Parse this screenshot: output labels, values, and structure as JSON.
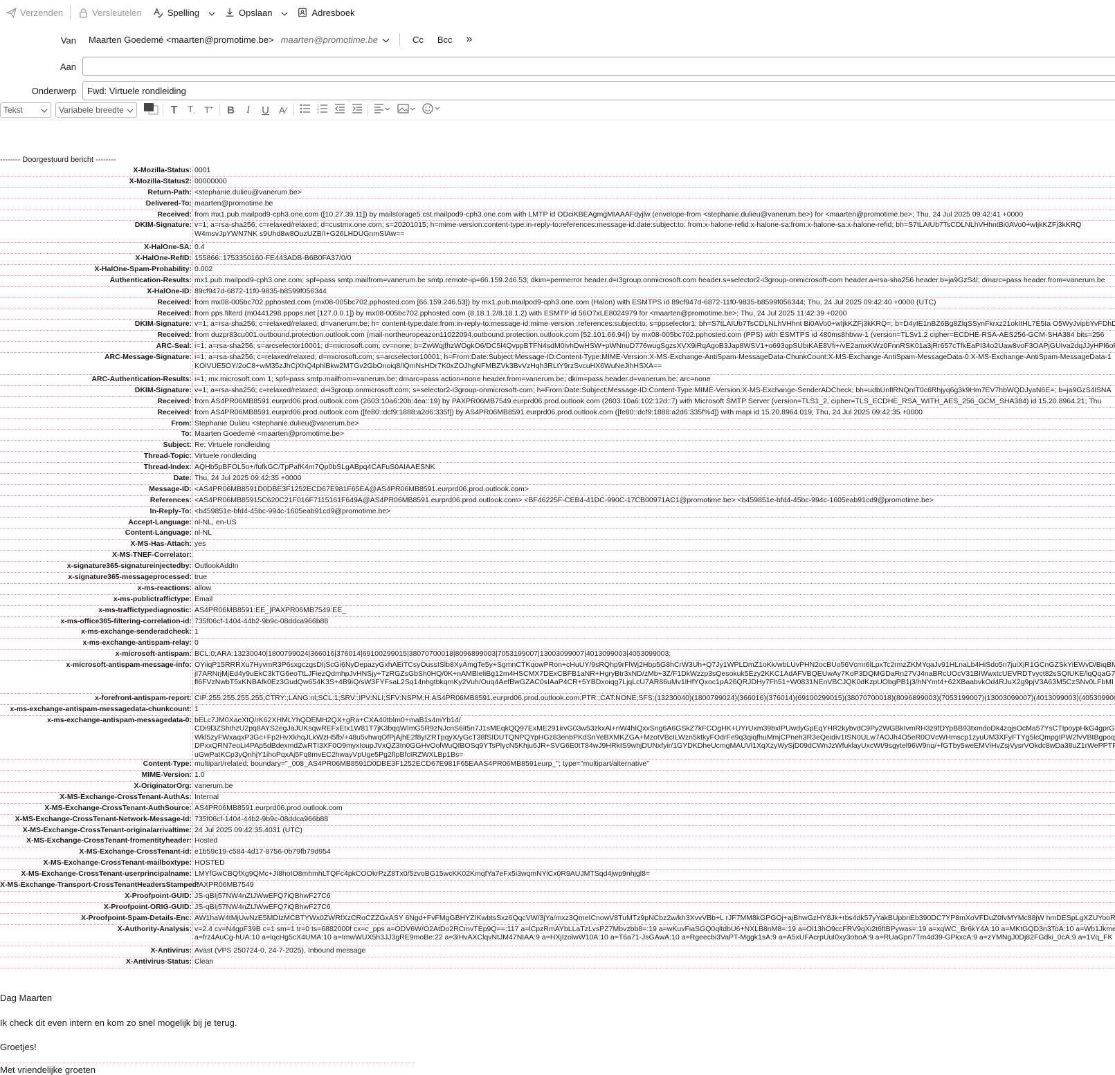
{
  "toolbar": {
    "send": "Verzenden",
    "encrypt": "Versleutelen",
    "spelling": "Spelling",
    "save": "Opslaan",
    "addressbook": "Adresboek"
  },
  "compose": {
    "from_label": "Van",
    "from_value": "Maarten Goedemé <maarten@promotime.be>",
    "from_alt": "maarten@promotime.be",
    "cc": "Cc",
    "bcc": "Bcc",
    "more": "»",
    "to_label": "Aan",
    "to_value": "",
    "subject_label": "Onderwerp",
    "subject_value": "Fwd: Virtuele rondleiding"
  },
  "format": {
    "paragraph": "Tekst",
    "font": "Variabele breedte"
  },
  "body": {
    "forward_header": "-------- Doorgestuurd bericht --------",
    "headers": [
      {
        "name": "X-Mozilla-Status:",
        "value": "0001"
      },
      {
        "name": "X-Mozilla-Status2:",
        "value": "00000000"
      },
      {
        "name": "Return-Path:",
        "value": "<stephanie.dulieu@vanerum.be>"
      },
      {
        "name": "Delivered-To:",
        "value": "maarten@promotime.be"
      },
      {
        "name": "Received:",
        "value": "from mx1.pub.mailpod9-cph3.one.com ([10.27.39.11]) by mailstorage5.cst.mailpod9-cph3.one.com with LMTP id ODciKBEAgmgMIAAAFdyjlw (envelope-from <stephanie.dulieu@vanerum.be>) for <maarten@promotime.be>; Thu, 24 Jul 2025 09:42:41 +0000"
      },
      {
        "name": "DKIM-Signature:",
        "value": "v=1; a=rsa-sha256; c=relaxed/relaxed; d=custmx.one.com; s=20201015; h=mime-version:content-type:in-reply-to:references:message-id:date:subject:to: from:x-halone-refid:x-halone-sa:from:x-halone-sa:x-halone-refid; bh=S7tLAIUb7TsCDLNLhVHhntBi0AVo0+wIjkKZFj3kKRQ\nW4msvJpYWN7NK s9Uhd8w8OuzUZB/I+G26LHDUGnmSIAw==",
        "rows": 2
      },
      {
        "name": "X-HalOne-SA:",
        "value": "0.4"
      },
      {
        "name": "X-HalOne-RefID:",
        "value": "155866::1753350160-FE443ADB-B6B0FA37/0/0"
      },
      {
        "name": "X-HalOne-Spam-Probability:",
        "value": "0.002"
      },
      {
        "name": "Authentication-Results:",
        "value": "mx1.pub.mailpod9-cph3.one.com; spf=pass smtp.mailfrom=vanerum.be smtp.remote-ip=66.159.246.53; dkim=permerror header.d=i3group.onmicrosoft.com header.s=selector2-i3group-onmicrosoft-com header.a=rsa-sha256 header.b=ja9GzS4l; dmarc=pass header.from=vanerum.be"
      },
      {
        "name": "X-HalOne-ID:",
        "value": "89cf947d-6872-11f0-9835-b8599f056344"
      },
      {
        "name": "Received:",
        "value": "from mx08-005bc702.pphosted.com (mx08-005bc702.pphosted.com [66.159.246.53]) by mx1.pub.mailpod9-cph3.one.com (Halon) with ESMTPS id 89cf947d-6872-11f0-9835-b8599f056344; Thu, 24 Jul 2025 09:42:40 +0000 (UTC)"
      },
      {
        "name": "Received:",
        "value": "from pps.filterd (m0441298.ppops.net [127.0.0.1]) by mx08-005bc702.pphosted.com (8.18.1.2/8.18.1.2) with ESMTP id 56O7xLE8024979 for <maarten@promotime.be>; Thu, 24 Jul 2025 11:42:39 +0200"
      },
      {
        "name": "DKIM-Signature:",
        "value": "v=1; a=rsa-sha256; c=relaxed/relaxed; d=vanerum.be; h= content-type:date:from:in-reply-to:message-id:mime-version :references:subject:to; s=ppselector1; bh=S7tLAIUb7TsCDLNLhVHhnt Bi0AVo0+wIjkKZFj3kKRQ=; b=D4yIE1nBZ6Bg8ZlqSSynFkrxz21okItHL7E5Ia O5WyJvipbYvFDhD"
      },
      {
        "name": "Received:",
        "value": "from duzpr83cu001.outbound.protection.outlook.com (mail-northeuropeazon11022094.outbound.protection.outlook.com [52.101.66.94]) by mx08-005bc702.pphosted.com (PPS) with ESMTPS id 480ms8hbvw-1 (version=TLSv1.2 cipher=ECDHE-RSA-AES256-GCM-SHA384 bits=256"
      },
      {
        "name": "ARC-Seal:",
        "value": "i=1; a=rsa-sha256; s=arcselector10001; d=microsoft.com; cv=none; b=ZwWqjfhzWOgkO6/DC5l4QvppBTFN4sdM0ivhDwHSW+pWNnuD776wugSgzsXVX9iRqAgoB3Jap8WSV1+o693qpSUbiKAE8Vfi+/vE2amxKWz0FnnRSK01a3jRr657cTfkEaPI34o2Uaw8voF3OAPjGUIva2dqJJyHPl6oF"
      },
      {
        "name": "ARC-Message-Signature:",
        "value": "i=1; a=rsa-sha256; c=relaxed/relaxed; d=microsoft.com; s=arcselector10001; h=From:Date:Subject:Message-ID:Content-Type:MIME-Version:X-MS-Exchange-AntiSpam-MessageData-ChunkCount:X-MS-Exchange-AntiSpam-MessageData-0:X-MS-Exchange-AntiSpam-MessageData-1\nKOlVUE5OY/2oC8+wM35zJhCjXhQ4phlBkw2MTGv2GbOnoiq8/lQmNsHDr7K0xZOJhgNFMBZVk3BvVzHqh3RLtY9rzSvcuHX6WuNeJihHSXA==",
        "rows": 2
      },
      {
        "name": "ARC-Authentication-Results:",
        "value": "i=1; mx.microsoft.com 1; spf=pass smtp.mailfrom=vanerum.be; dmarc=pass action=none header.from=vanerum.be; dkim=pass header.d=vanerum.be; arc=none"
      },
      {
        "name": "DKIM-Signature:",
        "value": "v=1; a=rsa-sha256; c=relaxed/relaxed; d=i3group.onmicrosoft.com; s=selector2-i3group-onmicrosoft-com; h=From:Date:Subject:Message-ID:Content-Type:MIME-Version:X-MS-Exchange-SenderADCheck; bh=udbUnflRNQnIT0c6Rhjyq6g3k9Hm7EV7hbWQDJyaN6E=; b=ja9GzS4lSNA"
      },
      {
        "name": "Received:",
        "value": "from AS4PR06MB8591.eurprd06.prod.outlook.com (2603:10a6:20b:4ea::19) by PAXPR06MB7549.eurprd06.prod.outlook.com (2603:10a6:102:12d::7) with Microsoft SMTP Server (version=TLS1_2, cipher=TLS_ECDHE_RSA_WITH_AES_256_GCM_SHA384) id 15.20.8964.21; Thu"
      },
      {
        "name": "Received:",
        "value": "from AS4PR06MB8591.eurprd06.prod.outlook.com ([fe80::dcf9:1888:a2d6:335f]) by AS4PR06MB8591.eurprd06.prod.outlook.com ([fe80::dcf9:1888:a2d6:335f%4]) with mapi id 15.20.8964.019; Thu, 24 Jul 2025 09:42:35 +0000"
      },
      {
        "name": "From:",
        "value": "Stephanie Dulieu <stephanie.dulieu@vanerum.be>"
      },
      {
        "name": "To:",
        "value": "Maarten Goedemé <maarten@promotime.be>"
      },
      {
        "name": "Subject:",
        "value": "Re: Virtuele rondleiding"
      },
      {
        "name": "Thread-Topic:",
        "value": "Virtuele rondleiding"
      },
      {
        "name": "Thread-Index:",
        "value": "AQHb5pBFOL5o+/fufkGC/TpPafK4m7Qp0bSLgABpq4CAFuS0AIAAESNK"
      },
      {
        "name": "Date:",
        "value": "Thu, 24 Jul 2025 09:42:35 +0000"
      },
      {
        "name": "Message-ID:",
        "value": "<AS4PR06MB8591D0DBE3F1252ECD67E981F65EA@AS4PR06MB8591.eurprd06.prod.outlook.com>"
      },
      {
        "name": "References:",
        "value": "<AS4PR06MB85915C620C21F016F7115161F649A@AS4PR06MB8591.eurprd06.prod.outlook.com> <BF46225F-CEB4-41DC-990C-17CB00971AC1@promotime.be> <b459851e-bfd4-45bc-994c-1605eab91cd9@promotime.be>"
      },
      {
        "name": "In-Reply-To:",
        "value": "<b459851e-bfd4-45bc-994c-1605eab91cd9@promotime.be>"
      },
      {
        "name": "Accept-Language:",
        "value": "nl-NL, en-US"
      },
      {
        "name": "Content-Language:",
        "value": "nl-NL"
      },
      {
        "name": "X-MS-Has-Attach:",
        "value": "yes"
      },
      {
        "name": "X-MS-TNEF-Correlator:",
        "value": ""
      },
      {
        "name": "x-signature365-signatureinjectedby:",
        "value": "OutlookAddIn"
      },
      {
        "name": "x-signature365-messageprocessed:",
        "value": "true"
      },
      {
        "name": "x-ms-reactions:",
        "value": "allow"
      },
      {
        "name": "x-ms-publictraffictype:",
        "value": "Email"
      },
      {
        "name": "x-ms-traffictypediagnostic:",
        "value": "AS4PR06MB8591:EE_|PAXPR06MB7549:EE_"
      },
      {
        "name": "x-ms-office365-filtering-correlation-id:",
        "value": "735f06cf-1404-44b2-9b9c-08ddca966b88"
      },
      {
        "name": "x-ms-exchange-senderadcheck:",
        "value": "1"
      },
      {
        "name": "x-ms-exchange-antispam-relay:",
        "value": "0"
      },
      {
        "name": "x-microsoft-antispam:",
        "value": "BCL:0;ARA:13230040|1800799024|366016|376014|69100299015|38070700018|8096899003|7053199007|13003099007|4013099003|4053099003;"
      },
      {
        "name": "x-microsoft-antispam-message-info:",
        "value": "OYiiqP15RRRXu7HyvmR3P6sxgczgsDIjScGi6NyDepazyGxhAEiTCsyOussISlb8XyAmgTe5y+SgmnCTKqowPRon+cHuUY/9sRQhp9rFlWj2Hbp5G8hCrW3Uh+Q7Jy1WPLDmZ1oKk/wbLUvPHN2ocBUo56Vcmr6lLpxTc2rmzZKMYqaJv91HLnaLb4HiSdo5n7juiXjR1GCnGZSkYiEWvD/BiqBMdlD\njI7ARNrjMjEd4y9uEkC3kTG6eoTtLJFiezQdmhpJvHNSjy+TzRGZsGbSh0HQ/0K+nAMBIeliBg12m4HSCMX7DExCBFB1aNR+HgryBtr3xND/zMb+3Z/F1DkWzzp3sQesokuk5Ezy2KKC1AdAFVBQEUwAy7KoP3DQMGDaRn27VJ4naBRcUOcV31BIWwxtcUEVRDTvyct82sSQIUKE/lqQqaG7Q1\nfl6FVzNwbT5xKNBAfk0Ez3GudQw654K3S+4B9iQ/sW3FYFsaL2Sq14nhgtbkqmKy2Vuh/Ouq4AefBwGZAC0sIAaP4CR+5YBDxoiqg7LjqLcU7AR86uMv1lHfYQxoc1pA26QRJDHy7Fh51+W0831NEnVBCJQK0dKzpUObgPB1j3/hNYmt4+62XBaabvkOd4RJuX2g9pjV3A63M5CzSNv0LFbMI",
        "rows": 3
      },
      {
        "name": "x-forefront-antispam-report:",
        "value": "CIP:255.255.255.255;CTRY:;LANG:nl;SCL:1;SRV:;IPV:NLI;SFV:NSPM;H:AS4PR06MB8591.eurprd06.prod.outlook.com;PTR:;CAT:NONE;SFS:(13230040)(1800799024)(366016)(376014)(69100299015)(38070700018)(8096899003)(7053199007)(13003099007)(4013099003)(4053099003)"
      },
      {
        "name": "x-ms-exchange-antispam-messagedata-chunkcount:",
        "value": "1"
      },
      {
        "name": "x-ms-exchange-antispam-messagedata-0:",
        "value": "bELc7JM0XaeXtQ/rK62XHMLYhQDEMH2QX+gRa+CXA40tbIm0+maB1s4mYb14/\nCDi9l3ZShthzU2pq8AYS2egJaJUKsqwREFxEtx1W81T7jK3bqqWImG5R9zNJcnS6it5n7J1sMEqkQQ97ExME291irvG03w53zkxAl+nW4hIQxxSng6A6GSkZ7kFCOgHK+UYrUxm39bxIPUwdyGpEqYHR2kybvdC9Py2WGBkIvmRH3z9fDYpBB93txmdoDk4zqjsOcMa57YsCTIpoypHkG4gprGuW\nWkl5zyFWxaqxP3Gc+Fp2HvXkhqJLkWzH5fb/+48u5vhwqOfPjAjhE2f8yIZRTpqyX/yGcT38fSIDUTQNPQYpHGz83enbPKdSnYeBXMKZGA+MzotVBcILWzn5ktkyFOdrFe9q3qiqfhuMmjCPneh3R3eQeidiv1tSN0ULw7AOJh4O5eR0OVcWHmscp1zyuUM3XFyFTYg5lcQmpgIPW2fvVBtBgpoq\nDPxxQRN7eoLi4PAp5dBdexmdZwRTI3XF0O9myxIoupJVxQZ3In0GGHvOolWuQIBOSq9YTsPlycN5Khju6JR+SVG6E0tT84wJ9HRkIS9whjDUNxfyir/1GYDKDheUcmgMAUVl1XqXzyWySjD09dCWnJzWfuklayUxcWt/9sgytel96W9nq/+fGTby5weEMViHvZsjVysrVOkdc8wDa38uZ1rWePPTF\nuGwPatKCp3yQnhjY1ihoPqxAj5Fq8mvEC2hwayVpUge5Pg2fIpBfcIRZWXLBp1Bs=",
        "rows": 5
      },
      {
        "name": "Content-Type:",
        "value": "multipart/related; boundary=\"_008_AS4PR06MB8591D0DBE3F1252ECD67E981F65EAAS4PR06MB8591eurp_\"; type=\"multipart/alternative\""
      },
      {
        "name": "MIME-Version:",
        "value": "1.0"
      },
      {
        "name": "X-OriginatorOrg:",
        "value": "vanerum.be"
      },
      {
        "name": "X-MS-Exchange-CrossTenant-AuthAs:",
        "value": "Internal"
      },
      {
        "name": "X-MS-Exchange-CrossTenant-AuthSource:",
        "value": "AS4PR06MB8591.eurprd06.prod.outlook.com"
      },
      {
        "name": "X-MS-Exchange-CrossTenant-Network-Message-Id:",
        "value": "735f06cf-1404-44b2-9b9c-08ddca966b88"
      },
      {
        "name": "X-MS-Exchange-CrossTenant-originalarrivaltime:",
        "value": "24 Jul 2025 09:42:35.4031 (UTC)"
      },
      {
        "name": "X-MS-Exchange-CrossTenant-fromentityheader:",
        "value": "Hosted"
      },
      {
        "name": "X-MS-Exchange-CrossTenant-id:",
        "value": "e1b59c19-c584-4d17-8756-0b79fb79d954"
      },
      {
        "name": "X-MS-Exchange-CrossTenant-mailboxtype:",
        "value": "HOSTED"
      },
      {
        "name": "X-MS-Exchange-CrossTenant-userprincipalname:",
        "value": "LMYfGwCBQfXg9QMc+JI8hoIO8mhmhLTQFc4pkCOOkrPzZ8Tx0/5zvoBG15wcKK02KmqfYa7eFx5i3wqmNYiCx0R9AUJMTSqd4jwp9nhjgl8="
      },
      {
        "name": "X-MS-Exchange-Transport-CrossTenantHeadersStamped:",
        "value": "PAXPR06MB7549"
      },
      {
        "name": "X-Proofpoint-GUID:",
        "value": "JS-qBIj57NW4nZtJWwEFQ7iQBhwF27C6"
      },
      {
        "name": "X-Proofpoint-ORIG-GUID:",
        "value": "JS-qBIj57NW4nZtJWwEFQ7iQBhwF27C6"
      },
      {
        "name": "X-Proofpoint-Spam-Details-Enc:",
        "value": "AW1haW4tMjUwNzE5MDIzMCBTYWx0ZWRfXzCRoCZZGxASY 6Ngd+FvFMgGBHYZIKwbtsSxz6QqcVW/3jYa/mxz3QmeICnowV8TuMTz9pNCbz2w/kh3XvvVBb+L rJF7MM8kGPGOj+ajBhwGzHY8Jk+rbs4dk57yYakBUpbriEb390DC7YP8mXoVFDuZ0fvMYMc88jW hmDESpLgXZUYooRo"
      },
      {
        "name": "X-Authority-Analysis:",
        "value": "v=2.4 cv=N4gpF39B c=1 sm=1 tr=0 ts=6882000f cx=c_pps a=ODV6W/O2AtDo2RCmvTEp9Q==:117 a=lCpzRmAYbLLaTzLvsPZ7Mbvzbb8=:19 a=wKuvFiaSGQ0qltdbU6+NXLB8nM8=:19 a=Ol13hO9ccFRV9qXi2t6ftBPywas=:19 a=xqWC_Br6kY4A:10 a=MKtGQD3n3ToA:10 a=Wb1JkmetP80A:10\na=frz4AuCg-hUA:10 a=lqcHg5cX4UMA:10 a=ImwWUX5h3JJ3gRE9moBe:22 a=3iHvAXClqvNtJM47NIAA:9 a=HXjIzolwW10A:10 a=T6a71-JsGAwA:10 a=Rgeecbi3VaPT-Mggk1sA:9 a=A5xUFAcrpUuI0xy3oboA:9 a=RUaGpn7Tm4d39-GPkxcA:9 a=zYMNgJ0Dj82FGdki_0cA:9 a=1Vq_FK",
        "rows": 2
      },
      {
        "name": "X-Antivirus:",
        "value": "Avast (VPS 250724-0, 24-7-2025), Inbound message"
      },
      {
        "name": "X-Antivirus-Status:",
        "value": "Clean"
      }
    ],
    "greeting": "Dag Maarten",
    "message": "Ik check dit even intern en kom zo snel mogelijk bij je terug.",
    "closing": "Groetjes!",
    "signature": "Met vriendelijke groeten"
  }
}
